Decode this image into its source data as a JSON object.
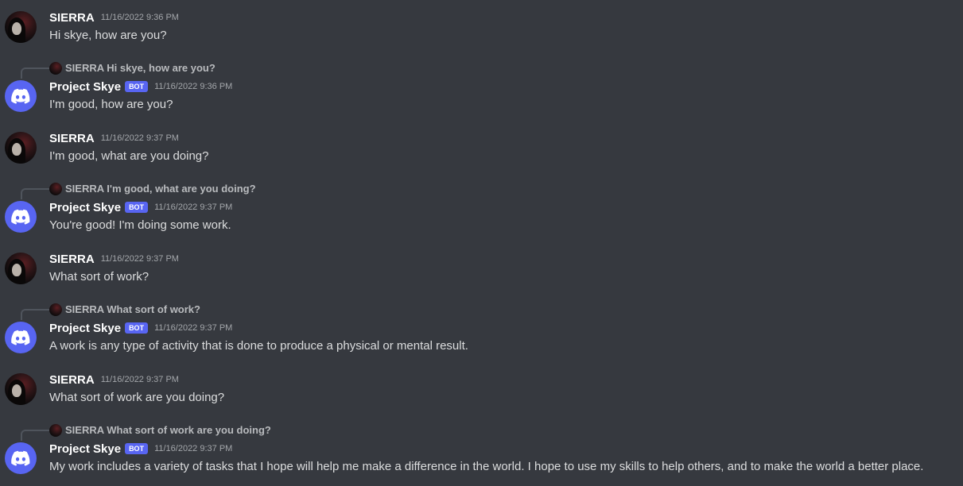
{
  "messages": [
    {
      "author": "SIERRA",
      "timestamp": "11/16/2022 9:36 PM",
      "content": "Hi skye, how are you?"
    },
    {
      "reply_author": "SIERRA",
      "reply_text": "Hi skye, how are you?",
      "author": "Project Skye",
      "bot_tag": "BOT",
      "timestamp": "11/16/2022 9:36 PM",
      "content": "I'm good, how are you?"
    },
    {
      "author": "SIERRA",
      "timestamp": "11/16/2022 9:37 PM",
      "content": "I'm good, what are you doing?"
    },
    {
      "reply_author": "SIERRA",
      "reply_text": "I'm good, what are you doing?",
      "author": "Project Skye",
      "bot_tag": "BOT",
      "timestamp": "11/16/2022 9:37 PM",
      "content": "You're good! I'm doing some work."
    },
    {
      "author": "SIERRA",
      "timestamp": "11/16/2022 9:37 PM",
      "content": "What sort of work?"
    },
    {
      "reply_author": "SIERRA",
      "reply_text": "What sort of work?",
      "author": "Project Skye",
      "bot_tag": "BOT",
      "timestamp": "11/16/2022 9:37 PM",
      "content": "A work is any type of activity that is done to produce a physical or mental result."
    },
    {
      "author": "SIERRA",
      "timestamp": "11/16/2022 9:37 PM",
      "content": "What sort of work are you doing?"
    },
    {
      "reply_author": "SIERRA",
      "reply_text": "What sort of work are you doing?",
      "author": "Project Skye",
      "bot_tag": "BOT",
      "timestamp": "11/16/2022 9:37 PM",
      "content": "My work includes a variety of tasks that I hope will help me make a difference in the world. I hope to use my skills to help others, and to make the world a better place."
    }
  ]
}
